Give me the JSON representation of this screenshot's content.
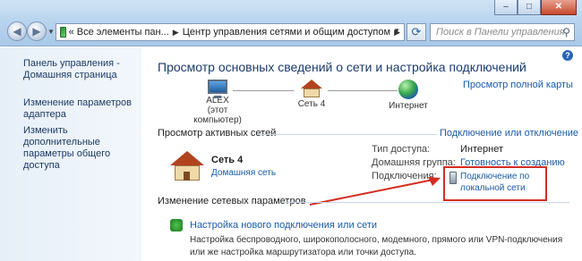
{
  "window": {
    "minimize": "–",
    "maximize": "□",
    "close": "✕"
  },
  "nav": {
    "back": "◀",
    "forward": "▶"
  },
  "address": {
    "overflow": "«",
    "crumbs": [
      "Все элементы пан...",
      "Центр управления сетями и общим доступом"
    ]
  },
  "search": {
    "placeholder": "Поиск в Панели управления"
  },
  "sidebar": {
    "items": [
      {
        "label": "Панель управления -\nДомашняя страница"
      },
      {
        "label": "Изменение параметров\nадаптера"
      },
      {
        "label": "Изменить дополнительные\nпараметры общего доступа"
      }
    ]
  },
  "main": {
    "title": "Просмотр основных сведений о сети и настройка подключений",
    "map_link": "Просмотр полной карты",
    "map": {
      "computer_name": "ALEX",
      "computer_caption": "(этот компьютер)",
      "network": "Сеть 4",
      "internet": "Интернет"
    },
    "active_networks_header": "Просмотр активных сетей",
    "connect_link": "Подключение или отключение",
    "network": {
      "name": "Сеть 4",
      "type": "Домашняя сеть"
    },
    "props": {
      "access_label": "Тип доступа:",
      "access_value": "Интернет",
      "homegroup_label": "Домашняя группа:",
      "homegroup_value": "Готовность к созданию",
      "connections_label": "Подключения:",
      "connections_value_line1": "Подключение по",
      "connections_value_line2": "локальной сети"
    },
    "change_settings_header": "Изменение сетевых параметров",
    "setup": {
      "link": "Настройка нового подключения или сети",
      "desc": "Настройка беспроводного, широкополосного, модемного, прямого или VPN-подключения\nили же настройка маршрутизатора или точки доступа."
    }
  },
  "colors": {
    "link": "#1a5aa8",
    "highlight_box": "#d42d22",
    "arrow": "#d42d22"
  }
}
